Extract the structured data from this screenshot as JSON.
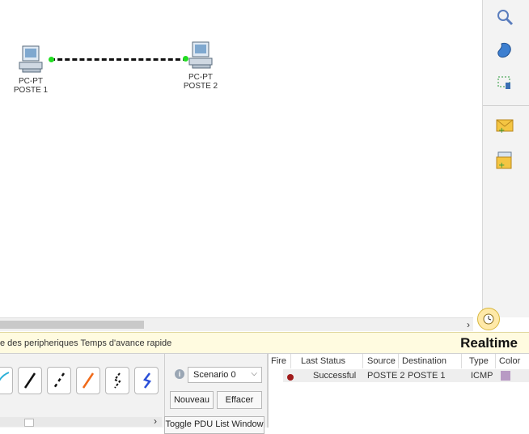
{
  "topology": {
    "devices": [
      {
        "model": "PC-PT",
        "name": "POSTE 1"
      },
      {
        "model": "PC-PT",
        "name": "POSTE 2"
      }
    ],
    "link_style": "dashed",
    "port_status_color": "#22dd22"
  },
  "right_toolbar": {
    "tools": [
      "zoom-icon",
      "resize-shape-icon",
      "select-area-icon",
      "add-simple-pdu-icon",
      "add-complex-pdu-icon"
    ]
  },
  "statusbar": {
    "left_text": "e des peripheriques  Temps d'avance rapide",
    "mode": "Realtime"
  },
  "scenario": {
    "selected": "Scenario 0",
    "new_label": "Nouveau",
    "delete_label": "Effacer",
    "toggle_label": "Toggle PDU List Window"
  },
  "pdu_list": {
    "headers": [
      "Fire",
      "Last Status",
      "Source",
      "Destination",
      "Type",
      "Color"
    ],
    "rows": [
      {
        "last_status": "Successful",
        "source": "POSTE 2",
        "destination": "POSTE 1",
        "type": "ICMP",
        "color": "#b89ac4"
      }
    ]
  },
  "colors": {
    "statusbar_bg": "#fffbe0",
    "fire_indicator": "#a01a1a"
  }
}
